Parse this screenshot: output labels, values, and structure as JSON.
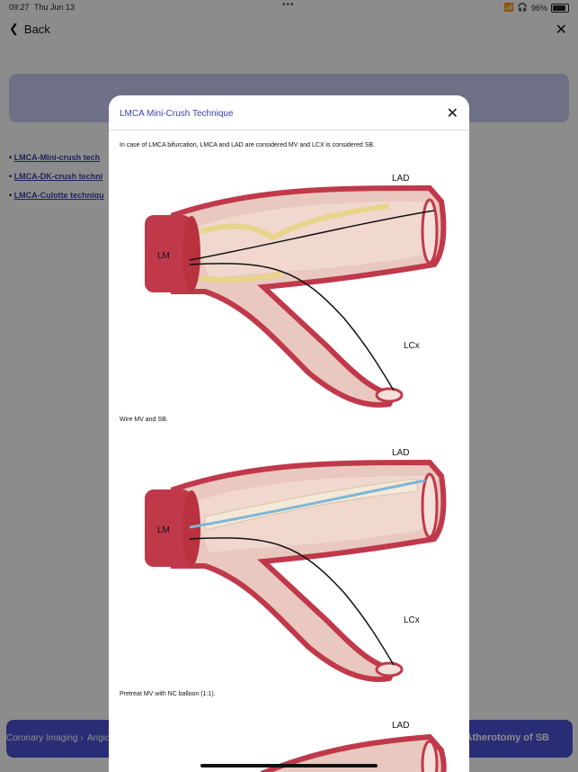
{
  "status": {
    "time": "09:27",
    "date": "Thu Jun 13",
    "battery": "96%"
  },
  "nav": {
    "back_label": "Back"
  },
  "links": [
    "LMCA-Mini-crush tech",
    "LMCA-DK-crush techni",
    "LMCA-Culotte techniqu"
  ],
  "bottom": {
    "crumb1": "Coronary Imaging",
    "crumb2": "Angic",
    "cta": "Atherotomy of SB"
  },
  "modal": {
    "title": "LMCA Mini-Crush Technique",
    "p1": "In case of LMCA bifurcation, LMCA and LAD are considered MV and LCX is considered SB.",
    "p2": "Wire MV and SB.",
    "p3": "Pretreat MV with NC balloon (1:1).",
    "labels": {
      "lad": "LAD",
      "lm": "LM",
      "lcx": "LCx"
    }
  },
  "colors": {
    "accent": "#3a3fb0",
    "banner": "#c9cdf5",
    "bottombar": "#4b53d6"
  }
}
